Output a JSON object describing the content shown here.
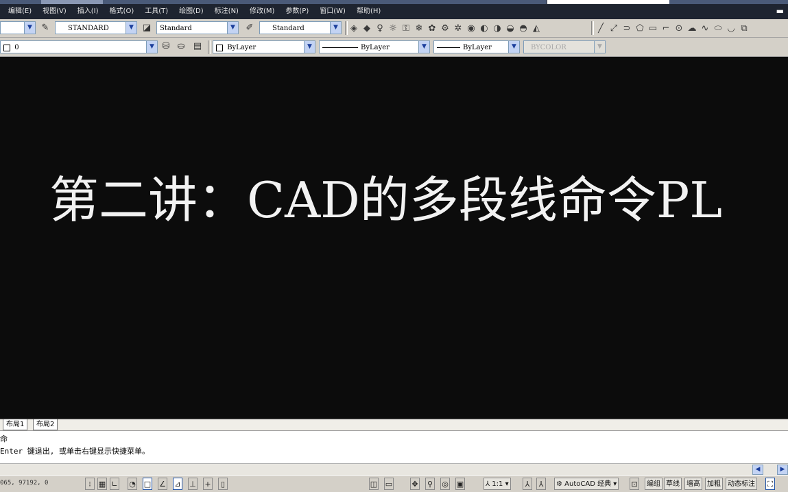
{
  "menu": {
    "items": [
      "编辑(E)",
      "视图(V)",
      "插入(I)",
      "格式(O)",
      "工具(T)",
      "绘图(D)",
      "标注(N)",
      "修改(M)",
      "参数(P)",
      "窗口(W)",
      "帮助(H)"
    ]
  },
  "toolbar": {
    "text_style": "STANDARD",
    "dim_style": "Standard",
    "table_style": "Standard",
    "layer": "0",
    "color": "ByLayer",
    "linetype": "ByLayer",
    "lineweight": "ByLayer",
    "plot_style": "BYCOLOR"
  },
  "canvas": {
    "lecture_title": "第二讲：CAD的多段线命令PL",
    "background_color": "#0c0c0c",
    "text_color": "#f2f2f2"
  },
  "tabs": {
    "items": [
      "布局1",
      "布局2"
    ]
  },
  "command": {
    "line1": "命",
    "line2": "Enter 键退出, 或单击右键显示快捷菜单。"
  },
  "status": {
    "coords": "065, 97192, 0",
    "annotation_scale": "1:1",
    "workspace": "AutoCAD 经典",
    "buttons": [
      "编组",
      "草线",
      "墙高",
      "加粗",
      "动态标注"
    ]
  }
}
